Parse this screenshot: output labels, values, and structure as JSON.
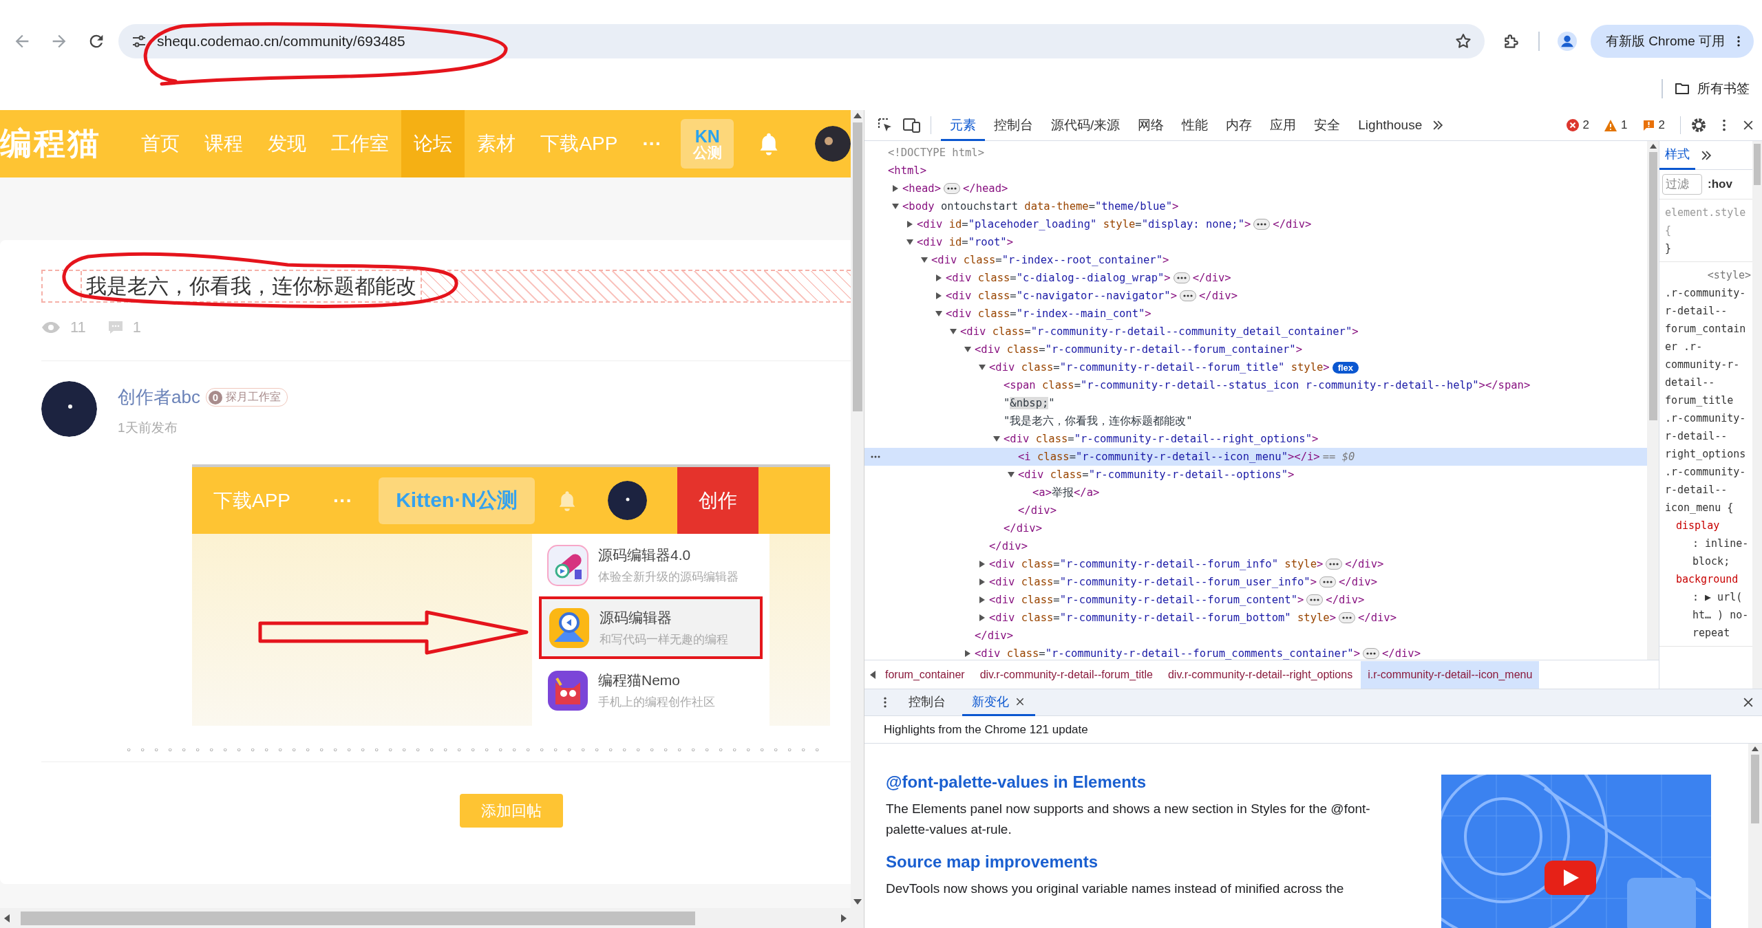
{
  "browser": {
    "url": "shequ.codemao.cn/community/693485",
    "update_button": "有新版 Chrome 可用",
    "bookmarks_folder": "所有书签"
  },
  "site": {
    "logo": "编程猫",
    "nav": [
      {
        "label": "首页",
        "selected": false
      },
      {
        "label": "课程",
        "selected": false
      },
      {
        "label": "发现",
        "selected": false
      },
      {
        "label": "工作室",
        "selected": false
      },
      {
        "label": "论坛",
        "selected": true
      },
      {
        "label": "素材",
        "selected": false
      },
      {
        "label": "下载APP",
        "selected": false
      }
    ],
    "more": "···",
    "beta_badge": {
      "top": "KN",
      "bottom": "公测"
    }
  },
  "post": {
    "title": "我是老六，你看我，连你标题都能改",
    "views": "11",
    "comments": "1",
    "author": "创作者abc",
    "studio_level": "0",
    "studio": "探月工作室",
    "posted": "1天前发布",
    "screenshot": {
      "nav_item": "下载APP",
      "more": "···",
      "badge": "Kitten·N公测",
      "create_button": "创作",
      "menu": [
        {
          "title": "源码编辑器4.0",
          "subtitle": "体验全新升级的源码编辑器",
          "selected": false
        },
        {
          "title": "源码编辑器",
          "subtitle": "和写代码一样无趣的编程",
          "selected": true
        },
        {
          "title": "编程猫Nemo",
          "subtitle": "手机上的编程创作社区",
          "selected": false
        }
      ]
    },
    "body_text": "。。。。。。。。。。。。。。。。。。。。。。。。。。。。。。。。。。。。。。。。。。。。。。。。。。。",
    "reply_button": "添加回帖"
  },
  "devtools": {
    "tabs": [
      {
        "label": "元素",
        "selected": true
      },
      {
        "label": "控制台",
        "selected": false
      },
      {
        "label": "源代码/来源",
        "selected": false
      },
      {
        "label": "网络",
        "selected": false
      },
      {
        "label": "性能",
        "selected": false
      },
      {
        "label": "内存",
        "selected": false
      },
      {
        "label": "应用",
        "selected": false
      },
      {
        "label": "安全",
        "selected": false
      },
      {
        "label": "Lighthouse",
        "selected": false
      }
    ],
    "errors": "2",
    "warnings": "1",
    "issues": "2",
    "tree": [
      {
        "kind": "doctype",
        "markup": "<!DOCTYPE html>",
        "selected": false
      },
      {
        "kind": "element",
        "markup": "<html>",
        "selected": false,
        "children": [
          {
            "kind": "element",
            "markup": "<head>",
            "end": "</head>",
            "expanded": false,
            "selected": false
          },
          {
            "kind": "element",
            "markup": "<body ontouchstart data-theme=\"theme/blue\">",
            "expanded": true,
            "selected": false,
            "children": [
              {
                "kind": "element",
                "markup": "<div id=\"placehoder_loading\" style=\"display: none;\">",
                "end": "</div>",
                "expanded": false,
                "selected": false
              },
              {
                "kind": "element",
                "markup": "<div id=\"root\">",
                "expanded": true,
                "selected": false,
                "children": [
                  {
                    "kind": "element",
                    "markup": "<div class=\"r-index--root_container\">",
                    "expanded": true,
                    "selected": false,
                    "children": [
                      {
                        "kind": "element",
                        "markup": "<div class=\"c-dialog--dialog_wrap\">",
                        "end": "</div>",
                        "expanded": false,
                        "selected": false
                      },
                      {
                        "kind": "element",
                        "markup": "<div class=\"c-navigator--navigator\">",
                        "end": "</div>",
                        "expanded": false,
                        "selected": false
                      },
                      {
                        "kind": "element",
                        "markup": "<div class=\"r-index--main_cont\">",
                        "expanded": true,
                        "selected": false,
                        "children": [
                          {
                            "kind": "element",
                            "markup": "<div class=\"r-community-r-detail--community_detail_container\">",
                            "expanded": true,
                            "selected": false,
                            "children": [
                              {
                                "kind": "element",
                                "markup": "<div class=\"r-community-r-detail--forum_container\">",
                                "end": "</div>",
                                "expanded": true,
                                "selected": false,
                                "children": [
                                  {
                                    "kind": "element",
                                    "markup": "<div class=\"r-community-r-detail--forum_title\" style>",
                                    "badge": "flex",
                                    "end": "</div>",
                                    "expanded": true,
                                    "selected": false,
                                    "children": [
                                      {
                                        "kind": "element",
                                        "markup": "<span class=\"r-community-r-detail--status_icon r-community-r-detail--help\"></span>",
                                        "selected": false
                                      },
                                      {
                                        "kind": "text",
                                        "markup": "\"&nbsp;\"",
                                        "selected": false
                                      },
                                      {
                                        "kind": "text",
                                        "markup": "\"我是老六，你看我，连你标题都能改\"",
                                        "selected": false
                                      },
                                      {
                                        "kind": "element",
                                        "markup": "<div class=\"r-community-r-detail--right_options\">",
                                        "end": "</div>",
                                        "expanded": true,
                                        "selected": false,
                                        "children": [
                                          {
                                            "kind": "element",
                                            "markup": "<i class=\"r-community-r-detail--icon_menu\"></i>",
                                            "note": "== $0",
                                            "selected": true
                                          },
                                          {
                                            "kind": "element",
                                            "markup": "<div class=\"r-community-r-detail--options\">",
                                            "end": "</div>",
                                            "expanded": true,
                                            "selected": false,
                                            "children": [
                                              {
                                                "kind": "element",
                                                "markup": "<a>举报</a>",
                                                "selected": false
                                              }
                                            ]
                                          }
                                        ]
                                      }
                                    ]
                                  },
                                  {
                                    "kind": "element",
                                    "markup": "<div class=\"r-community-r-detail--forum_info\" style>",
                                    "end": "</div>",
                                    "expanded": false,
                                    "selected": false
                                  },
                                  {
                                    "kind": "element",
                                    "markup": "<div class=\"r-community-r-detail--forum_user_info\">",
                                    "end": "</div>",
                                    "expanded": false,
                                    "selected": false
                                  },
                                  {
                                    "kind": "element",
                                    "markup": "<div class=\"r-community-r-detail--forum_content\">",
                                    "end": "</div>",
                                    "expanded": false,
                                    "selected": false
                                  },
                                  {
                                    "kind": "element",
                                    "markup": "<div class=\"r-community-r-detail--forum_bottom\" style>",
                                    "end": "</div>",
                                    "expanded": false,
                                    "selected": false
                                  }
                                ]
                              },
                              {
                                "kind": "element",
                                "markup": "<div class=\"r-community-r-detail--forum_comments_container\">",
                                "end": "</div>",
                                "expanded": false,
                                "selected": false
                              }
                            ]
                          }
                        ]
                      }
                    ]
                  }
                ]
              }
            ]
          }
        ]
      }
    ],
    "breadcrumbs": [
      {
        "label": "forum_container",
        "selected": false
      },
      {
        "label": "div.r-community-r-detail--forum_title",
        "selected": false
      },
      {
        "label": "div.r-community-r-detail--right_options",
        "selected": false
      },
      {
        "label": "i.r-community-r-detail--icon_menu",
        "selected": true
      }
    ],
    "styles": {
      "tab": "样式",
      "filter_placeholder": "过滤",
      "state_toggle": ":hov",
      "element_rule": {
        "selector": "element.style {",
        "close": "}"
      },
      "rule": {
        "origin": "<style>",
        "selector": ".r-community-r-detail--forum_container .r-community-r-detail--forum_title .r-community-r-detail--right_options .r-community-r-detail--icon_menu {",
        "declarations": [
          {
            "property": "display",
            "value": ": inline-block;"
          },
          {
            "property": "background",
            "value": ": ▶ url( ht… ) no-repeat"
          }
        ]
      }
    },
    "drawer": {
      "tabs": [
        {
          "label": "控制台",
          "selected": false,
          "closable": false
        },
        {
          "label": "新变化",
          "selected": true,
          "closable": true
        }
      ],
      "header": "Highlights from the Chrome 121 update",
      "sections": [
        {
          "kind": "heading",
          "text": "@font-palette-values in Elements"
        },
        {
          "kind": "paragraph",
          "text": "The Elements panel now supports and shows a new section in Styles for the @font-palette-values at-rule."
        },
        {
          "kind": "heading",
          "text": "Source map improvements"
        },
        {
          "kind": "paragraph",
          "text": "DevTools now shows you original variable names instead of minified across the"
        }
      ]
    }
  }
}
